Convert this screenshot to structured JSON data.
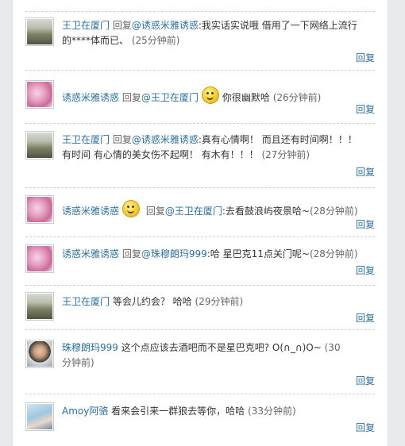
{
  "comments": [
    {
      "name": "王卫在厦门",
      "reply_word": "回复",
      "mention": "@诱惑米雅诱惑",
      "content": ":我实话实说哦 借用了一下网络上流行的****体而已、",
      "time": "(25分钟前)",
      "reply_label": "回复",
      "avatar": "city-avatar"
    },
    {
      "name": "诱惑米雅诱惑",
      "reply_word": "回复",
      "mention": "@王卫在厦门",
      "content": "你很幽默哈",
      "time": "(26分钟前)",
      "reply_label": "回复",
      "avatar": "pink-flower-avatar",
      "emoji": "grin-emoji"
    },
    {
      "name": "王卫在厦门",
      "reply_word": "回复",
      "mention": "@诱惑米雅诱惑",
      "content": ":真有心情啊！ 而且还有时间啊！！！ 有时间 有心情的美女伤不起啊！ 有木有！！！",
      "time": "(27分钟前)",
      "reply_label": "回复",
      "avatar": "city-avatar"
    },
    {
      "name": "诱惑米雅诱惑",
      "reply_word": "回复",
      "mention": "@王卫在厦门",
      "content": ":去看鼓浪屿夜景哈~",
      "time": "(28分钟前)",
      "reply_label": "回复",
      "avatar": "pink-flower-avatar",
      "emoji": "smile-emoji"
    },
    {
      "name": "诱惑米雅诱惑",
      "reply_word": "回复",
      "mention": "@珠穆朗玛999",
      "content": ":哈 星巴克11点关门呢~",
      "time": "(28分钟前)",
      "reply_label": "回复",
      "avatar": "pink-flower-avatar"
    },
    {
      "name": "王卫在厦门",
      "content": "等会儿约会？ 哈哈",
      "time": "(29分钟前)",
      "reply_label": "回复",
      "avatar": "city-avatar"
    },
    {
      "name": "珠穆朗玛999",
      "content": "这个点应该去酒吧而不是星巴克吧? O(∩_∩)O~",
      "time": "(30分钟前)",
      "reply_label": "回复",
      "avatar": "man-avatar"
    },
    {
      "name": "Amoy阿骆",
      "content": "看来会引来一群狼去等你，哈哈",
      "time": "(33分钟前)",
      "reply_label": "回复",
      "avatar": "girl-avatar"
    }
  ]
}
